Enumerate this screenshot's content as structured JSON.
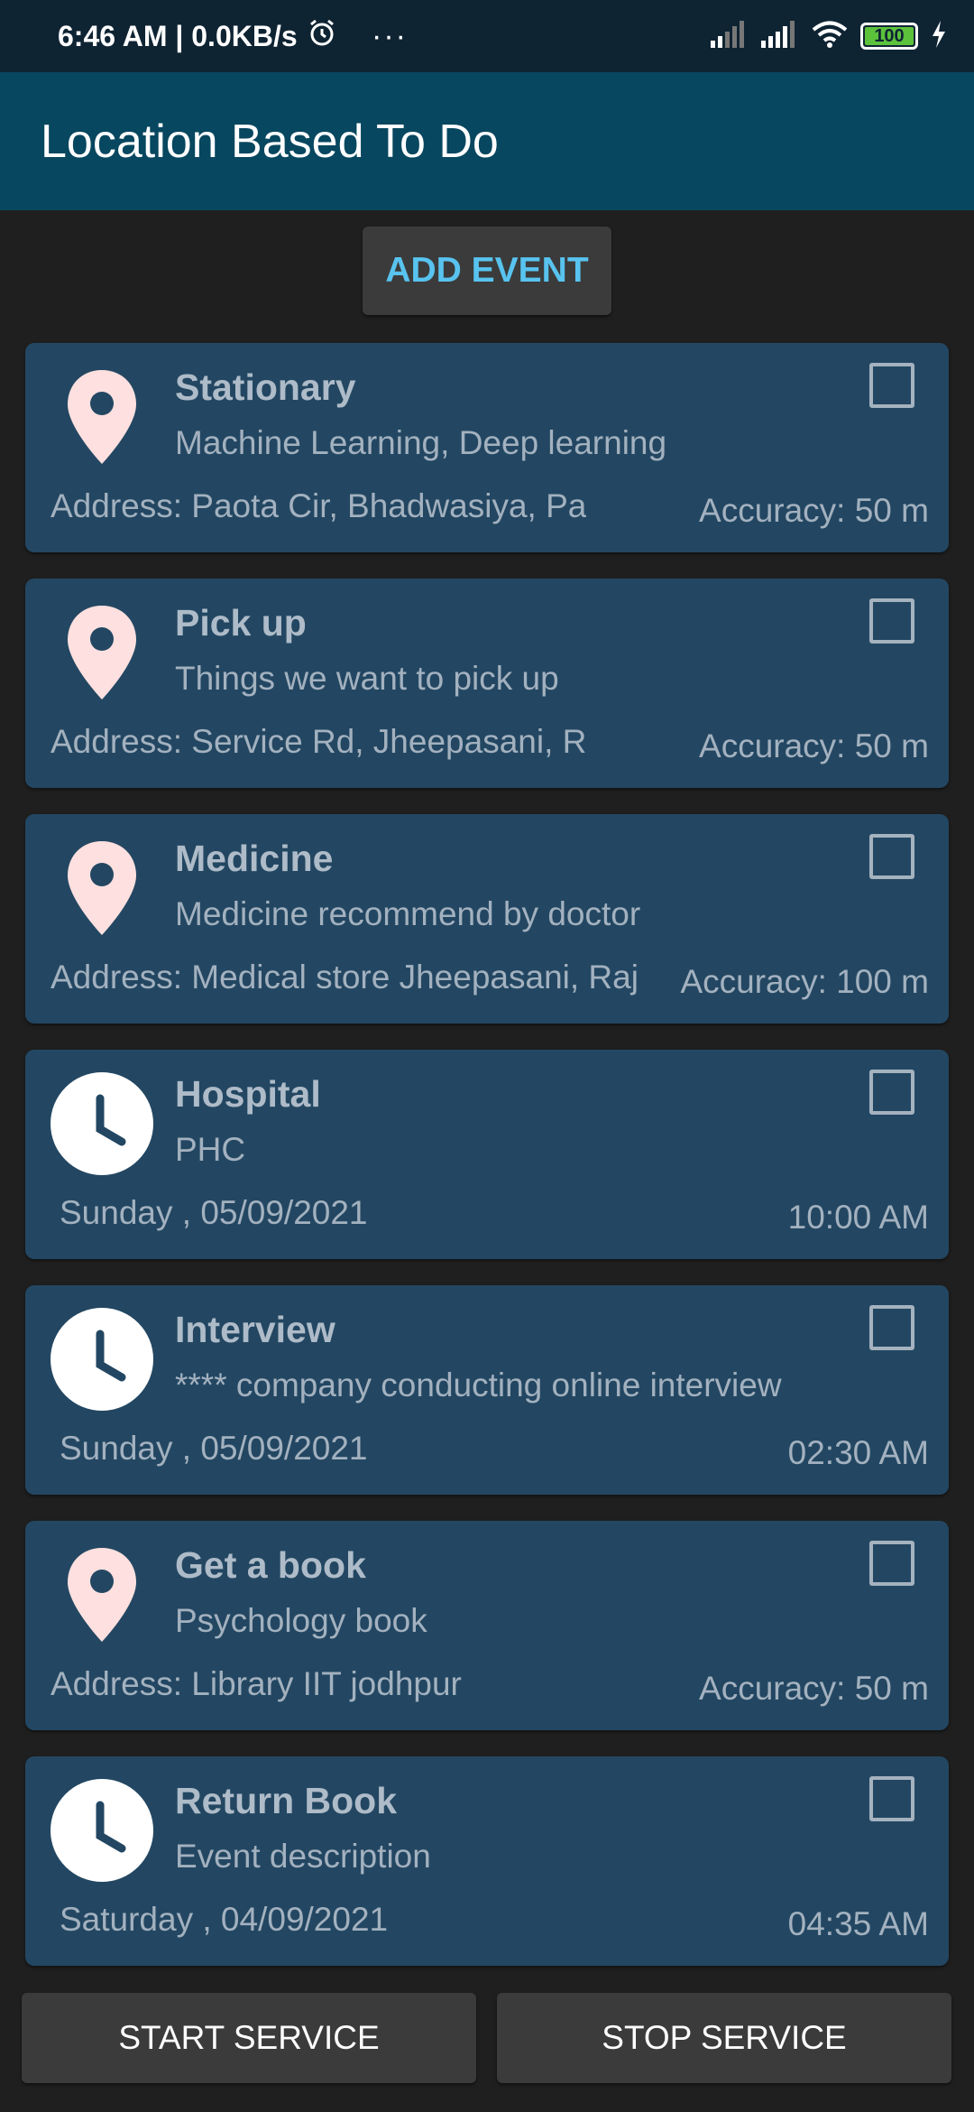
{
  "status_bar": {
    "time_speed": "6:46 AM | 0.0KB/s",
    "alarm_icon": "alarm-clock-icon",
    "dots": "···",
    "battery_level": "100",
    "icons": [
      "signal-icon",
      "signal-icon",
      "wifi-icon",
      "battery-icon",
      "charging-icon"
    ]
  },
  "app_bar": {
    "title": "Location Based To Do"
  },
  "add_button": {
    "label": "ADD EVENT"
  },
  "events": [
    {
      "type": "location",
      "icon": "location-pin-icon",
      "title": "Stationary",
      "description": "Machine Learning, Deep learning",
      "left": "Address: Paota Cir, Bhadwasiya, Pa",
      "right": "Accuracy: 50 m",
      "checked": false
    },
    {
      "type": "location",
      "icon": "location-pin-icon",
      "title": "Pick up",
      "description": "Things we want to pick up",
      "left": "Address: Service Rd, Jheepasani, R",
      "right": "Accuracy: 50 m",
      "checked": false
    },
    {
      "type": "location",
      "icon": "location-pin-icon",
      "title": "Medicine",
      "description": "Medicine recommend by doctor",
      "left": "Address: Medical store Jheepasani, Raj",
      "right": "Accuracy: 100 m",
      "checked": false
    },
    {
      "type": "time",
      "icon": "clock-icon",
      "title": "Hospital",
      "description": "PHC",
      "left": "Sunday , 05/09/2021",
      "right": "10:00 AM",
      "checked": false
    },
    {
      "type": "time",
      "icon": "clock-icon",
      "title": "Interview",
      "description": "**** company conducting online interview",
      "left": "Sunday , 05/09/2021",
      "right": "02:30 AM",
      "checked": false
    },
    {
      "type": "location",
      "icon": "location-pin-icon",
      "title": "Get a book",
      "description": "Psychology book",
      "left": "Address: Library IIT jodhpur",
      "right": "Accuracy: 50 m",
      "checked": false
    },
    {
      "type": "time",
      "icon": "clock-icon",
      "title": "Return Book",
      "description": "Event description",
      "left": "Saturday , 04/09/2021",
      "right": "04:35 AM",
      "checked": false
    }
  ],
  "bottom_buttons": {
    "start": "START SERVICE",
    "stop": "STOP SERVICE"
  },
  "colors": {
    "status_bar": "#0f2433",
    "app_bar": "#07475f",
    "background": "#1f1f1f",
    "card": "#234762",
    "accent_text": "#58c3ef",
    "pin": "#fde0df",
    "battery": "#5cc23c"
  }
}
